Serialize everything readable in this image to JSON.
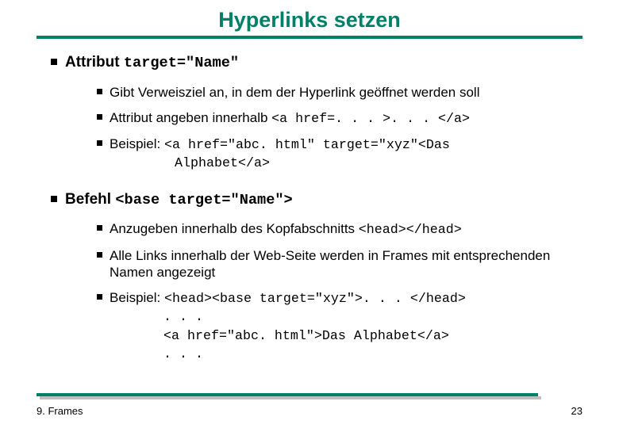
{
  "title": "Hyperlinks setzen",
  "b1": {
    "lead": "Attribut ",
    "code": "target=\"Name\"",
    "s1": "Gibt Verweisziel an, in dem der Hyperlink geöffnet werden soll",
    "s2_lead": "Attribut angeben innerhalb ",
    "s2_code": "<a href=. . . >. . . </a>",
    "s3_lead": "Beispiel: ",
    "s3_code1": "<a href=\"abc. html\" target=\"xyz\"<Das",
    "s3_code2": "Alphabet</a>"
  },
  "b2": {
    "lead": "Befehl ",
    "code": "<base target=\"Name\">",
    "s1_lead": "Anzugeben innerhalb des Kopfabschnitts ",
    "s1_code": "<head></head>",
    "s2": "Alle Links innerhalb der Web-Seite werden in Frames mit entsprechenden Namen angezeigt",
    "s3_lead": "Beispiel: ",
    "s3_code1": "<head><base target=\"xyz\">. . . </head>",
    "s3_code2": ". . .",
    "s3_code3": "<a href=\"abc. html\">Das Alphabet</a>",
    "s3_code4": ". . ."
  },
  "footer": {
    "left": "9. Frames",
    "right": "23"
  }
}
